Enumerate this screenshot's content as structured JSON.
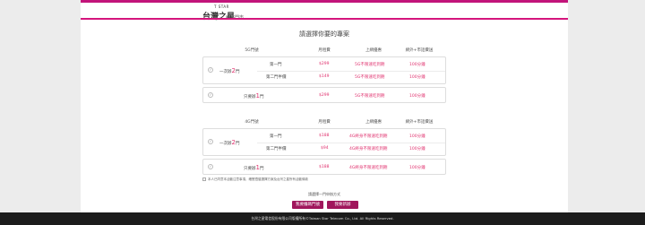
{
  "header": {
    "logo_en": "T STAR",
    "logo_cn": "台灣之星",
    "section_label": "網路門市"
  },
  "heading": "請選擇你要的專案",
  "columns": {
    "monthly": "月租費",
    "internet": "上網優惠",
    "calls": "網外+市話費送"
  },
  "plan_5g": {
    "title": "5G門號",
    "bundle_label_pre": "一次辦",
    "bundle_count": "2",
    "bundle_label_post": "門",
    "line1": {
      "label": "第一門",
      "price": "$299",
      "internet": "5G不限速吃到飽",
      "calls": "100分鐘"
    },
    "line2": {
      "label": "第二門半價",
      "price": "$149",
      "internet": "5G不限速吃到飽",
      "calls": "100分鐘"
    },
    "single_label_pre": "只要辦",
    "single_count": "1",
    "single_label_post": "門",
    "single": {
      "price": "$299",
      "internet": "5G不限速吃到飽",
      "calls": "100分鐘"
    }
  },
  "plan_4g": {
    "title": "4G門號",
    "bundle_label_pre": "一次辦",
    "bundle_count": "2",
    "bundle_label_post": "門",
    "line1": {
      "label": "第一門",
      "price": "$188",
      "internet": "4G終身不限速吃到飽",
      "calls": "100分鐘"
    },
    "line2": {
      "label": "第二門半價",
      "price": "$94",
      "internet": "4G終身不限速吃到飽",
      "calls": "100分鐘"
    },
    "single_label_pre": "只要辦",
    "single_count": "1",
    "single_label_post": "門",
    "single": {
      "price": "$188",
      "internet": "4G終身不限速吃到飽",
      "calls": "100分鐘"
    }
  },
  "note": "本人已同意本活動注意事項，確實遵循選擇方案及台灣之星所有活動條款",
  "confirm_text": "請選擇一門申辦方式",
  "buttons": {
    "number_transfer": "我要攜碼門號",
    "new_number": "我要新辦"
  },
  "footer": "台灣之星電信股份有限公司版權所有©Taiwan Star Telecom Co., Ltd. All Rights Reserved.",
  "colors": {
    "accent": "#c2147a",
    "price": "#e0316e",
    "button": "#a0165c"
  }
}
